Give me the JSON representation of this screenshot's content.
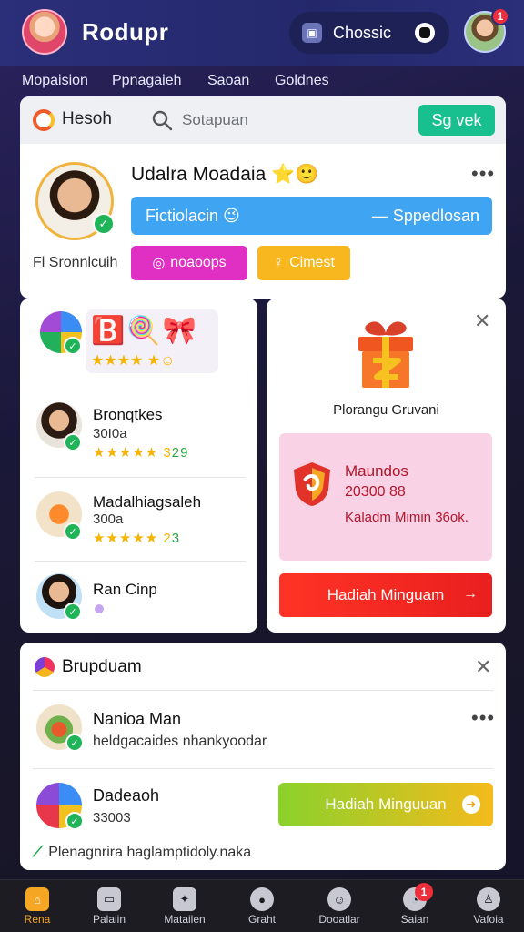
{
  "header": {
    "app_title": "Rodupr",
    "choose_label": "Chossic",
    "notif_count": "1"
  },
  "subnav": [
    "Mopaision",
    "Ppnagaieh",
    "Saoan",
    "Goldnes"
  ],
  "search_card": {
    "brand": "Hesoh",
    "search_placeholder": "Sotapuan",
    "sign_button": "Sg vek",
    "user_name": "Udalra Moadaia ⭐🙂",
    "blue_left": "Fictiolacin 😉",
    "blue_right": "— Sppedlosan",
    "user_sub": "Fl Sronnlcuih",
    "magenta_button": "noaoops",
    "yellow_button": "Cimest"
  },
  "list_card": {
    "badge_emojis": "🅱️🍭🎀",
    "badge_stars": "★★★★ ★☺",
    "rows": [
      {
        "title": "Bronqtkes",
        "num": "30I0a",
        "stars": "★★★★★ 3",
        "score": "29"
      },
      {
        "title": "Madalhiagsaleh",
        "num": "300a",
        "stars": "★★★★★ 2",
        "score": "3"
      },
      {
        "title": "Ran Cinp"
      }
    ]
  },
  "reward_card": {
    "caption": "Plorangu Gruvani",
    "pink_title": "Maundos",
    "pink_number": "20300 88",
    "pink_desc": "Kaladm Mimin 36ok.",
    "button": "Hadiah Minguam",
    "button_arrow": "→"
  },
  "feed_card": {
    "title": "Brupduam",
    "item1_title": "Nanioa Man",
    "item1_desc": "heldgacaides nhankyoodar",
    "item2_title": "Dadeaoh",
    "item2_num": "33003",
    "button": "Hadiah Minguuan",
    "footer": "Plenagnrira haglamptidoly.naka"
  },
  "bottom_nav": [
    {
      "label": "Rena",
      "icon": "home-icon"
    },
    {
      "label": "Palaiin",
      "icon": "tablet-icon"
    },
    {
      "label": "Matailen",
      "icon": "bird-icon"
    },
    {
      "label": "Graht",
      "icon": "user-icon"
    },
    {
      "label": "Dooatlar",
      "icon": "face-icon"
    },
    {
      "label": "Saian",
      "icon": "chat-icon"
    },
    {
      "label": "Vafoia",
      "icon": "person-icon"
    }
  ],
  "nav_badge": "1",
  "colors": {
    "topbar": "#2b2f7a",
    "sign_button": "#18c08f",
    "blue_bar": "#3fa4f2",
    "magenta": "#e02fc3",
    "yellow": "#f8b71f",
    "red_button": "#ff3325",
    "green_button": "#8bd12b",
    "pink_panel": "#f9d2e6",
    "nav_active": "#f5a623"
  }
}
